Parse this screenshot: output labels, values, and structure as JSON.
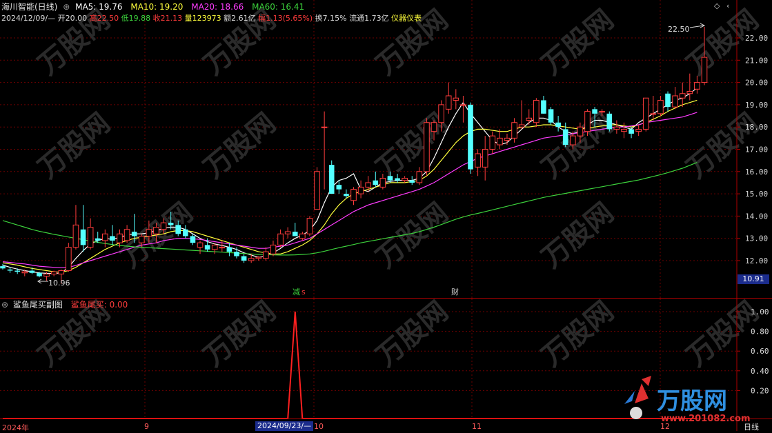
{
  "header": {
    "stock_name": "海川智能(日线)",
    "ma5_label": "MA5: 19.76",
    "ma10_label": "MA10: 19.20",
    "ma20_label": "MA20: 18.66",
    "ma60_label": "MA60: 16.41",
    "date": "2024/12/09/—",
    "open_label": "开20.00",
    "high_label": "高22.50",
    "low_label": "低19.88",
    "close_label": "收21.13",
    "volume_label": "量123973",
    "amount_label": "额2.61亿",
    "change_label": "幅1.13(5.65%)",
    "turnover_label": "换7.15%",
    "float_label": "流通1.73亿",
    "industry_label": "仪器仪表"
  },
  "colors": {
    "ma5": "#ffffff",
    "ma10": "#ffff3c",
    "ma20": "#ff3cff",
    "ma60": "#3cd23c",
    "up": "#ff3c3c",
    "down": "#54ffff",
    "grid": "#6e0000"
  },
  "annotations": {
    "high_marker": "22.50",
    "low_marker": "10.96",
    "event_reduce": "减",
    "event_s": "s",
    "event_finance": "财",
    "current_price_box": "10.91"
  },
  "price_axis": {
    "ticks": [
      "22.00",
      "21.00",
      "20.00",
      "19.00",
      "18.00",
      "17.00",
      "16.00",
      "15.00",
      "14.00",
      "13.00",
      "12.00"
    ]
  },
  "sub_panel": {
    "title": "鲨鱼尾买副图",
    "indicator_label": "鲨鱼尾买: 0.00",
    "ticks": [
      "1.00",
      "0.80",
      "0.60",
      "0.40",
      "0.20"
    ]
  },
  "time_axis": {
    "labels": [
      "2024年",
      "9",
      "10",
      "11",
      "12"
    ],
    "cursor_date": "2024/09/23/—",
    "period_label": "日线"
  },
  "watermark": {
    "brand": "万股网",
    "url": "www.201082.com"
  },
  "chart_data": {
    "type": "candlestick",
    "ylim": [
      11.5,
      22.9
    ],
    "candles": [
      {
        "o": 11.75,
        "h": 11.85,
        "l": 11.6,
        "c": 11.65
      },
      {
        "o": 11.6,
        "h": 11.7,
        "l": 11.45,
        "c": 11.55
      },
      {
        "o": 11.55,
        "h": 11.65,
        "l": 11.4,
        "c": 11.5
      },
      {
        "o": 11.45,
        "h": 11.6,
        "l": 11.3,
        "c": 11.5
      },
      {
        "o": 11.55,
        "h": 11.7,
        "l": 11.4,
        "c": 11.45
      },
      {
        "o": 11.45,
        "h": 11.5,
        "l": 11.25,
        "c": 11.3
      },
      {
        "o": 11.3,
        "h": 11.5,
        "l": 11.1,
        "c": 11.4
      },
      {
        "o": 11.4,
        "h": 11.55,
        "l": 11.3,
        "c": 11.5
      },
      {
        "o": 11.4,
        "h": 11.6,
        "l": 10.96,
        "c": 11.55
      },
      {
        "o": 11.55,
        "h": 12.8,
        "l": 11.5,
        "c": 12.6
      },
      {
        "o": 12.6,
        "h": 14.5,
        "l": 12.5,
        "c": 13.6
      },
      {
        "o": 13.4,
        "h": 14.5,
        "l": 12.4,
        "c": 12.7
      },
      {
        "o": 12.6,
        "h": 13.9,
        "l": 12.5,
        "c": 13.5
      },
      {
        "o": 13.0,
        "h": 13.3,
        "l": 12.8,
        "c": 12.9
      },
      {
        "o": 12.9,
        "h": 13.4,
        "l": 12.6,
        "c": 13.2
      },
      {
        "o": 13.1,
        "h": 13.6,
        "l": 12.7,
        "c": 12.9
      },
      {
        "o": 12.8,
        "h": 13.4,
        "l": 12.6,
        "c": 13.2
      },
      {
        "o": 12.9,
        "h": 13.6,
        "l": 12.8,
        "c": 13.4
      },
      {
        "o": 13.3,
        "h": 14.1,
        "l": 12.8,
        "c": 13.1
      },
      {
        "o": 12.8,
        "h": 13.2,
        "l": 12.6,
        "c": 13.1
      },
      {
        "o": 13.1,
        "h": 13.8,
        "l": 12.8,
        "c": 13.4
      },
      {
        "o": 13.2,
        "h": 13.7,
        "l": 12.8,
        "c": 13.5
      },
      {
        "o": 13.4,
        "h": 13.9,
        "l": 13.2,
        "c": 13.7
      },
      {
        "o": 13.7,
        "h": 14.2,
        "l": 13.4,
        "c": 13.6
      },
      {
        "o": 13.6,
        "h": 13.8,
        "l": 13.1,
        "c": 13.2
      },
      {
        "o": 13.4,
        "h": 13.6,
        "l": 13.0,
        "c": 13.1
      },
      {
        "o": 13.1,
        "h": 13.2,
        "l": 12.7,
        "c": 12.8
      },
      {
        "o": 12.6,
        "h": 12.9,
        "l": 12.3,
        "c": 12.8
      },
      {
        "o": 12.7,
        "h": 13.0,
        "l": 12.4,
        "c": 12.5
      },
      {
        "o": 12.5,
        "h": 12.8,
        "l": 12.3,
        "c": 12.7
      },
      {
        "o": 12.6,
        "h": 12.9,
        "l": 12.4,
        "c": 12.6
      },
      {
        "o": 12.6,
        "h": 12.8,
        "l": 12.2,
        "c": 12.4
      },
      {
        "o": 12.4,
        "h": 12.6,
        "l": 12.1,
        "c": 12.2
      },
      {
        "o": 12.2,
        "h": 12.3,
        "l": 11.9,
        "c": 12.0
      },
      {
        "o": 12.0,
        "h": 12.3,
        "l": 11.9,
        "c": 12.1
      },
      {
        "o": 12.1,
        "h": 12.2,
        "l": 12.0,
        "c": 12.15
      },
      {
        "o": 12.1,
        "h": 12.6,
        "l": 12.0,
        "c": 12.4
      },
      {
        "o": 12.3,
        "h": 12.9,
        "l": 12.2,
        "c": 12.7
      },
      {
        "o": 12.7,
        "h": 13.4,
        "l": 12.6,
        "c": 13.2
      },
      {
        "o": 13.2,
        "h": 13.5,
        "l": 13.0,
        "c": 13.3
      },
      {
        "o": 13.3,
        "h": 13.7,
        "l": 13.1,
        "c": 13.1
      },
      {
        "o": 13.0,
        "h": 13.3,
        "l": 12.9,
        "c": 13.2
      },
      {
        "o": 13.2,
        "h": 14.0,
        "l": 13.1,
        "c": 13.9
      },
      {
        "o": 14.3,
        "h": 16.2,
        "l": 14.3,
        "c": 16.0
      },
      {
        "o": 18.0,
        "h": 18.7,
        "l": 15.2,
        "c": 18.0
      },
      {
        "o": 16.3,
        "h": 16.5,
        "l": 15.0,
        "c": 15.0
      },
      {
        "o": 15.4,
        "h": 15.6,
        "l": 15.0,
        "c": 15.2
      },
      {
        "o": 15.0,
        "h": 15.2,
        "l": 14.8,
        "c": 14.9
      },
      {
        "o": 14.7,
        "h": 15.3,
        "l": 14.5,
        "c": 15.2
      },
      {
        "o": 15.0,
        "h": 15.6,
        "l": 14.8,
        "c": 15.3
      },
      {
        "o": 15.3,
        "h": 15.8,
        "l": 15.1,
        "c": 15.5
      },
      {
        "o": 15.6,
        "h": 16.0,
        "l": 15.3,
        "c": 15.4
      },
      {
        "o": 15.3,
        "h": 15.9,
        "l": 15.2,
        "c": 15.7
      },
      {
        "o": 15.8,
        "h": 16.0,
        "l": 15.5,
        "c": 15.6
      },
      {
        "o": 15.7,
        "h": 15.9,
        "l": 15.5,
        "c": 15.6
      },
      {
        "o": 15.6,
        "h": 15.8,
        "l": 15.5,
        "c": 15.7
      },
      {
        "o": 15.6,
        "h": 15.8,
        "l": 15.4,
        "c": 15.5
      },
      {
        "o": 15.5,
        "h": 16.2,
        "l": 15.4,
        "c": 16.0
      },
      {
        "o": 16.0,
        "h": 18.4,
        "l": 15.8,
        "c": 18.2
      },
      {
        "o": 17.8,
        "h": 18.3,
        "l": 17.4,
        "c": 18.2
      },
      {
        "o": 18.2,
        "h": 19.2,
        "l": 17.8,
        "c": 19.0
      },
      {
        "o": 18.8,
        "h": 20.0,
        "l": 18.6,
        "c": 19.4
      },
      {
        "o": 19.2,
        "h": 19.7,
        "l": 18.8,
        "c": 19.3
      },
      {
        "o": 19.0,
        "h": 19.4,
        "l": 18.2,
        "c": 19.0
      },
      {
        "o": 19.0,
        "h": 19.1,
        "l": 15.9,
        "c": 16.1
      },
      {
        "o": 16.2,
        "h": 17.0,
        "l": 15.8,
        "c": 16.8
      },
      {
        "o": 16.2,
        "h": 17.6,
        "l": 15.6,
        "c": 17.0
      },
      {
        "o": 17.0,
        "h": 17.8,
        "l": 16.8,
        "c": 17.6
      },
      {
        "o": 17.2,
        "h": 17.9,
        "l": 17.0,
        "c": 17.5
      },
      {
        "o": 17.4,
        "h": 17.7,
        "l": 17.2,
        "c": 17.5
      },
      {
        "o": 17.5,
        "h": 18.4,
        "l": 17.3,
        "c": 18.2
      },
      {
        "o": 18.0,
        "h": 19.2,
        "l": 17.9,
        "c": 18.1
      },
      {
        "o": 18.3,
        "h": 18.8,
        "l": 18.1,
        "c": 18.4
      },
      {
        "o": 18.2,
        "h": 19.3,
        "l": 18.0,
        "c": 19.2
      },
      {
        "o": 19.2,
        "h": 19.4,
        "l": 18.6,
        "c": 18.6
      },
      {
        "o": 18.8,
        "h": 18.9,
        "l": 18.1,
        "c": 18.2
      },
      {
        "o": 18.2,
        "h": 18.5,
        "l": 17.8,
        "c": 18.0
      },
      {
        "o": 17.9,
        "h": 18.2,
        "l": 17.1,
        "c": 17.2
      },
      {
        "o": 17.2,
        "h": 17.8,
        "l": 17.0,
        "c": 17.6
      },
      {
        "o": 17.6,
        "h": 18.2,
        "l": 17.3,
        "c": 18.0
      },
      {
        "o": 17.8,
        "h": 18.8,
        "l": 17.6,
        "c": 18.7
      },
      {
        "o": 18.8,
        "h": 18.9,
        "l": 18.0,
        "c": 18.6
      },
      {
        "o": 18.7,
        "h": 18.8,
        "l": 18.5,
        "c": 18.7
      },
      {
        "o": 18.6,
        "h": 18.7,
        "l": 17.8,
        "c": 17.9
      },
      {
        "o": 17.9,
        "h": 18.3,
        "l": 17.7,
        "c": 18.0
      },
      {
        "o": 17.8,
        "h": 18.2,
        "l": 17.5,
        "c": 17.9
      },
      {
        "o": 17.9,
        "h": 18.0,
        "l": 17.5,
        "c": 17.7
      },
      {
        "o": 17.8,
        "h": 18.1,
        "l": 17.6,
        "c": 17.9
      },
      {
        "o": 17.9,
        "h": 19.3,
        "l": 17.8,
        "c": 19.3
      },
      {
        "o": 18.6,
        "h": 19.4,
        "l": 18.3,
        "c": 18.6
      },
      {
        "o": 18.6,
        "h": 19.4,
        "l": 18.5,
        "c": 19.2
      },
      {
        "o": 19.5,
        "h": 19.6,
        "l": 18.7,
        "c": 18.9
      },
      {
        "o": 18.9,
        "h": 19.8,
        "l": 18.8,
        "c": 19.4
      },
      {
        "o": 19.3,
        "h": 20.0,
        "l": 18.9,
        "c": 19.5
      },
      {
        "o": 19.5,
        "h": 20.4,
        "l": 19.2,
        "c": 19.6
      },
      {
        "o": 19.7,
        "h": 20.3,
        "l": 19.5,
        "c": 20.0
      },
      {
        "o": 20.0,
        "h": 22.5,
        "l": 19.88,
        "c": 21.13
      }
    ],
    "ma_series": [
      {
        "name": "MA5",
        "values": [
          11.8,
          11.7,
          11.62,
          11.55,
          11.5,
          11.45,
          11.43,
          11.42,
          11.45,
          11.7,
          12.1,
          12.45,
          12.75,
          12.9,
          13.0,
          12.95,
          13.05,
          13.15,
          13.2,
          13.2,
          13.25,
          13.35,
          13.45,
          13.5,
          13.5,
          13.4,
          13.2,
          13.0,
          12.85,
          12.75,
          12.68,
          12.6,
          12.5,
          12.35,
          12.25,
          12.15,
          12.2,
          12.35,
          12.55,
          12.8,
          13.0,
          13.15,
          13.35,
          13.8,
          14.6,
          15.3,
          15.6,
          15.7,
          15.9,
          15.2,
          15.1,
          15.3,
          15.5,
          15.55,
          15.6,
          15.6,
          15.6,
          15.7,
          16.0,
          16.6,
          17.3,
          18.0,
          18.6,
          19.1,
          18.6,
          18.2,
          17.8,
          17.4,
          17.2,
          17.3,
          17.6,
          17.9,
          18.2,
          18.4,
          18.4,
          18.3,
          18.0,
          17.8,
          17.7,
          17.8,
          18.1,
          18.3,
          18.3,
          18.2,
          18.1,
          18.0,
          17.9,
          18.2,
          18.4,
          18.6,
          18.8,
          19.0,
          19.2,
          19.3,
          19.5,
          19.76
        ]
      },
      {
        "name": "MA10",
        "values": [
          11.9,
          11.85,
          11.8,
          11.72,
          11.65,
          11.6,
          11.55,
          11.5,
          11.48,
          11.55,
          11.7,
          11.9,
          12.1,
          12.3,
          12.5,
          12.65,
          12.8,
          12.9,
          13.0,
          13.05,
          13.1,
          13.15,
          13.2,
          13.3,
          13.35,
          13.35,
          13.3,
          13.2,
          13.1,
          13.0,
          12.9,
          12.8,
          12.7,
          12.6,
          12.5,
          12.4,
          12.35,
          12.3,
          12.3,
          12.4,
          12.55,
          12.7,
          12.9,
          13.2,
          13.6,
          14.1,
          14.5,
          14.8,
          15.0,
          15.1,
          15.2,
          15.3,
          15.4,
          15.5,
          15.5,
          15.5,
          15.55,
          15.6,
          15.8,
          16.1,
          16.5,
          16.9,
          17.3,
          17.6,
          17.8,
          17.9,
          17.9,
          17.85,
          17.8,
          17.8,
          17.9,
          18.0,
          18.0,
          18.05,
          18.1,
          18.1,
          18.05,
          18.0,
          17.95,
          17.9,
          17.95,
          18.0,
          18.05,
          18.1,
          18.1,
          18.05,
          18.0,
          18.1,
          18.2,
          18.35,
          18.5,
          18.7,
          18.85,
          19.0,
          19.1,
          19.2
        ]
      },
      {
        "name": "MA20",
        "values": [
          11.95,
          11.92,
          11.88,
          11.85,
          11.8,
          11.75,
          11.72,
          11.7,
          11.68,
          11.7,
          11.78,
          11.9,
          12.0,
          12.1,
          12.2,
          12.3,
          12.4,
          12.5,
          12.6,
          12.7,
          12.75,
          12.8,
          12.9,
          12.95,
          13.0,
          13.0,
          12.98,
          12.95,
          12.9,
          12.85,
          12.8,
          12.75,
          12.7,
          12.65,
          12.6,
          12.55,
          12.55,
          12.6,
          12.65,
          12.7,
          12.8,
          12.9,
          13.0,
          13.2,
          13.4,
          13.6,
          13.8,
          14.0,
          14.2,
          14.35,
          14.5,
          14.6,
          14.7,
          14.8,
          14.9,
          15.0,
          15.1,
          15.2,
          15.35,
          15.5,
          15.7,
          15.9,
          16.1,
          16.3,
          16.45,
          16.6,
          16.7,
          16.8,
          16.9,
          17.0,
          17.1,
          17.2,
          17.3,
          17.4,
          17.5,
          17.55,
          17.6,
          17.65,
          17.7,
          17.75,
          17.8,
          17.85,
          17.9,
          17.95,
          18.0,
          18.0,
          18.05,
          18.1,
          18.2,
          18.25,
          18.3,
          18.35,
          18.4,
          18.45,
          18.55,
          18.66
        ]
      },
      {
        "name": "MA60",
        "values": [
          13.8,
          13.7,
          13.6,
          13.5,
          13.4,
          13.32,
          13.25,
          13.18,
          13.12,
          13.06,
          13.0,
          12.94,
          12.88,
          12.82,
          12.77,
          12.72,
          12.68,
          12.65,
          12.62,
          12.6,
          12.58,
          12.56,
          12.54,
          12.52,
          12.5,
          12.48,
          12.46,
          12.44,
          12.42,
          12.4,
          12.38,
          12.36,
          12.34,
          12.32,
          12.3,
          12.28,
          12.27,
          12.26,
          12.25,
          12.25,
          12.26,
          12.28,
          12.3,
          12.35,
          12.42,
          12.5,
          12.58,
          12.65,
          12.72,
          12.8,
          12.86,
          12.92,
          12.98,
          13.04,
          13.1,
          13.16,
          13.22,
          13.3,
          13.4,
          13.5,
          13.62,
          13.74,
          13.86,
          13.96,
          14.05,
          14.12,
          14.2,
          14.28,
          14.36,
          14.44,
          14.52,
          14.6,
          14.68,
          14.76,
          14.84,
          14.9,
          14.96,
          15.02,
          15.08,
          15.14,
          15.2,
          15.26,
          15.32,
          15.38,
          15.44,
          15.5,
          15.56,
          15.62,
          15.7,
          15.78,
          15.86,
          15.95,
          16.05,
          16.15,
          16.28,
          16.41
        ]
      }
    ],
    "sub_series": {
      "name": "鲨鱼尾买",
      "ylim": [
        0,
        1.05
      ],
      "values": [
        0,
        0,
        0,
        0,
        0,
        0,
        0,
        0,
        0,
        0,
        0,
        0,
        0,
        0,
        0,
        0,
        0,
        0,
        0,
        0,
        0,
        0,
        0,
        0,
        0,
        0,
        0,
        0,
        0,
        0,
        0,
        0,
        0,
        0,
        0,
        0,
        0,
        0,
        0,
        0,
        1,
        0,
        0,
        0,
        0,
        0,
        0,
        0,
        0,
        0,
        0,
        0,
        0,
        0,
        0,
        0,
        0,
        0,
        0,
        0,
        0,
        0,
        0,
        0,
        0,
        0,
        0,
        0,
        0,
        0,
        0,
        0,
        0,
        0,
        0,
        0,
        0,
        0,
        0,
        0,
        0,
        0,
        0,
        0,
        0,
        0,
        0,
        0,
        0,
        0,
        0,
        0,
        0,
        0,
        0,
        0
      ]
    }
  }
}
